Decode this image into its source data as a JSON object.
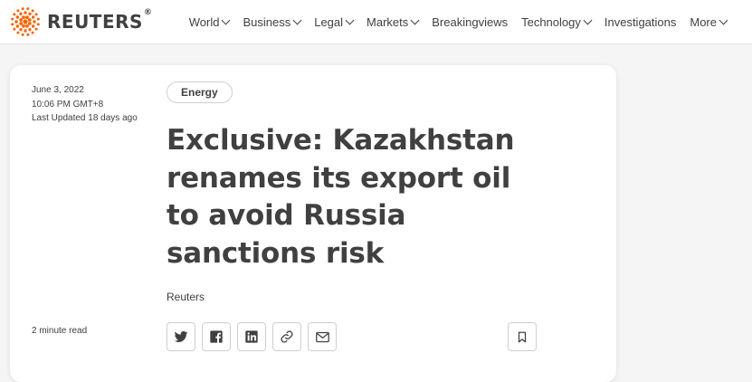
{
  "brand": {
    "name": "REUTERS",
    "reg": "®"
  },
  "nav": {
    "items": [
      {
        "label": "World",
        "dropdown": true
      },
      {
        "label": "Business",
        "dropdown": true
      },
      {
        "label": "Legal",
        "dropdown": true
      },
      {
        "label": "Markets",
        "dropdown": true
      },
      {
        "label": "Breakingviews",
        "dropdown": false
      },
      {
        "label": "Technology",
        "dropdown": true
      },
      {
        "label": "Investigations",
        "dropdown": false
      },
      {
        "label": "More",
        "dropdown": true
      }
    ]
  },
  "article": {
    "date": "June 3, 2022",
    "time": "10:06 PM GMT+8",
    "updated": "Last Updated 18 days ago",
    "tag": "Energy",
    "headline": "Exclusive: Kazakhstan renames its export oil to avoid Russia sanctions risk",
    "byline": "Reuters",
    "read_time": "2 minute read"
  },
  "share": {
    "icons": [
      "twitter-icon",
      "facebook-icon",
      "linkedin-icon",
      "link-icon",
      "email-icon"
    ],
    "save_icon": "bookmark-icon"
  },
  "colors": {
    "brand_orange": "#fa6400",
    "text": "#404040",
    "border": "#cfcfcf"
  }
}
